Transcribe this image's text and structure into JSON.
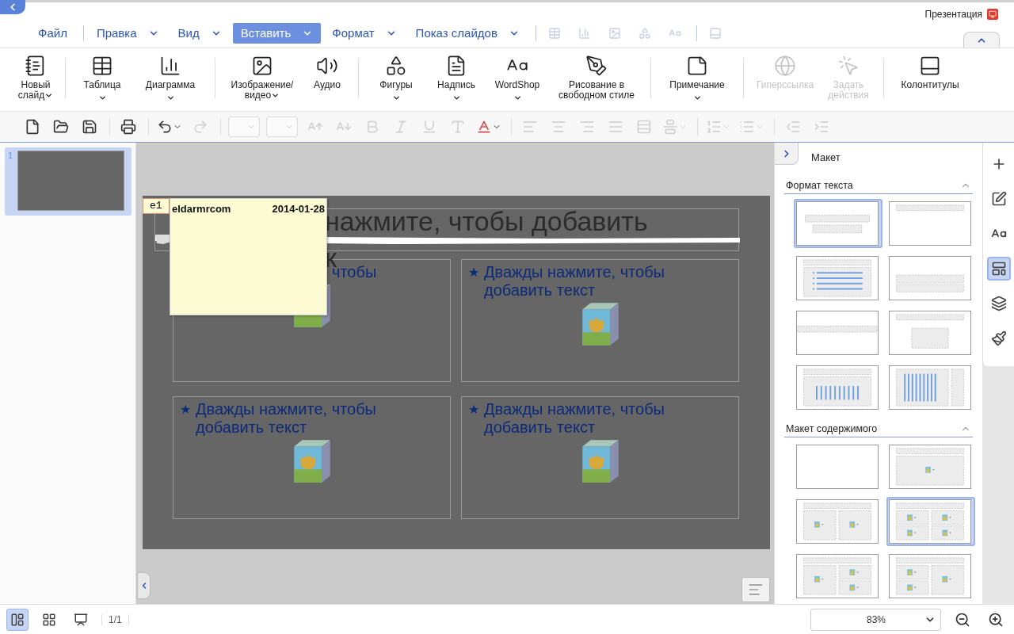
{
  "app": {
    "title": "Презентация"
  },
  "menu": [
    {
      "label": "Файл",
      "dropdown": false,
      "selected": false,
      "divider_before": false
    },
    {
      "label": "Правка",
      "dropdown": true,
      "selected": false,
      "divider_before": true
    },
    {
      "label": "Вид",
      "dropdown": true,
      "selected": false,
      "divider_before": false
    },
    {
      "label": "Вставить",
      "dropdown": true,
      "selected": true,
      "divider_before": false
    },
    {
      "label": "Формат",
      "dropdown": true,
      "selected": false,
      "divider_before": false
    },
    {
      "label": "Показ слайдов",
      "dropdown": true,
      "selected": false,
      "divider_before": false
    }
  ],
  "menu_icons": [
    {
      "kind": "table",
      "disabled": true,
      "divider_before": true
    },
    {
      "kind": "chart",
      "disabled": true,
      "divider_before": false
    },
    {
      "kind": "image",
      "disabled": true,
      "divider_before": false
    },
    {
      "kind": "shapes",
      "disabled": true,
      "divider_before": false
    },
    {
      "kind": "wordart",
      "disabled": true,
      "divider_before": false
    },
    {
      "kind": "footer",
      "disabled": true,
      "divider_before": true
    }
  ],
  "ribbon": [
    {
      "kind": "new-slide",
      "label": "Новый слайд",
      "dropdown": true,
      "disabled": false,
      "divider_before": false
    },
    {
      "kind": "table",
      "label": "Таблица",
      "dropdown": true,
      "disabled": false,
      "divider_before": true
    },
    {
      "kind": "chart",
      "label": "Диаграмма",
      "dropdown": true,
      "disabled": false,
      "divider_before": false
    },
    {
      "kind": "image",
      "label": "Изображение/ видео",
      "dropdown": true,
      "disabled": false,
      "divider_before": true
    },
    {
      "kind": "audio",
      "label": "Аудио",
      "dropdown": false,
      "disabled": false,
      "divider_before": false
    },
    {
      "kind": "shapes",
      "label": "Фигуры",
      "dropdown": true,
      "disabled": false,
      "divider_before": true
    },
    {
      "kind": "textbox",
      "label": "Надпись",
      "dropdown": true,
      "disabled": false,
      "divider_before": false
    },
    {
      "kind": "wordart",
      "label": "WordShop",
      "dropdown": true,
      "disabled": false,
      "divider_before": false
    },
    {
      "kind": "freehand",
      "label": "Рисование в свободном стиле",
      "dropdown": false,
      "disabled": false,
      "divider_before": false
    },
    {
      "kind": "note",
      "label": "Примечание",
      "dropdown": true,
      "disabled": false,
      "divider_before": true
    },
    {
      "kind": "hyperlink",
      "label": "Гиперссылка",
      "dropdown": false,
      "disabled": true,
      "divider_before": true
    },
    {
      "kind": "action",
      "label": "Задать действия",
      "dropdown": false,
      "disabled": true,
      "divider_before": false
    },
    {
      "kind": "header-footer",
      "label": "Колонтитулы",
      "dropdown": false,
      "disabled": false,
      "divider_before": true
    }
  ],
  "format_toolbar": [
    {
      "kind": "new",
      "disabled": false,
      "divider_before": false
    },
    {
      "kind": "open",
      "disabled": false,
      "divider_before": false
    },
    {
      "kind": "save",
      "disabled": false,
      "divider_before": false
    },
    {
      "kind": "print",
      "disabled": false,
      "divider_before": true
    },
    {
      "kind": "undo",
      "disabled": false,
      "divider_before": true
    },
    {
      "kind": "redo",
      "disabled": true,
      "divider_before": false
    },
    {
      "kind": "font-select",
      "disabled": true,
      "divider_before": true
    },
    {
      "kind": "size-select",
      "disabled": true,
      "divider_before": false
    },
    {
      "kind": "grow",
      "disabled": true,
      "divider_before": false
    },
    {
      "kind": "shrink",
      "disabled": true,
      "divider_before": false
    },
    {
      "kind": "bold",
      "disabled": true,
      "divider_before": false
    },
    {
      "kind": "italic",
      "disabled": true,
      "divider_before": false
    },
    {
      "kind": "underline",
      "disabled": true,
      "divider_before": false
    },
    {
      "kind": "shadow",
      "disabled": true,
      "divider_before": false
    },
    {
      "kind": "font-color",
      "disabled": false,
      "divider_before": false
    },
    {
      "kind": "align-left",
      "disabled": true,
      "divider_before": true
    },
    {
      "kind": "align-center",
      "disabled": true,
      "divider_before": false
    },
    {
      "kind": "align-right",
      "disabled": true,
      "divider_before": false
    },
    {
      "kind": "justify",
      "disabled": true,
      "divider_before": false
    },
    {
      "kind": "distribute",
      "disabled": true,
      "divider_before": false
    },
    {
      "kind": "valign",
      "disabled": true,
      "divider_before": false
    },
    {
      "kind": "numbering",
      "disabled": true,
      "divider_before": true
    },
    {
      "kind": "bullets",
      "disabled": true,
      "divider_before": false
    },
    {
      "kind": "outdent",
      "disabled": true,
      "divider_before": true
    },
    {
      "kind": "indent",
      "disabled": true,
      "divider_before": false
    }
  ],
  "slides": [
    {
      "number": "1",
      "selected": true
    }
  ],
  "slide": {
    "title": {
      "lines": [
        "нажмите, чтобы добавить",
        "к"
      ],
      "covered": true
    },
    "placeholders": [
      {
        "text": "чтобы",
        "covered": true
      },
      {
        "text": "Дважды нажмите, чтобы добавить текст",
        "bullet": "★",
        "covered": false
      },
      {
        "text": "Дважды нажмите, чтобы добавить текст",
        "bullet": "★",
        "covered": false
      },
      {
        "text": "Дважды нажмите, чтобы добавить текст",
        "bullet": "★",
        "covered": false
      }
    ],
    "comment": {
      "tag": "e1",
      "author": "eldarmrcom",
      "date": "2014-01-28"
    }
  },
  "panel": {
    "title": "Макет",
    "sections": [
      {
        "title": "Формат текста",
        "expanded": true,
        "layouts": [
          {
            "kind": "title",
            "selected": true
          },
          {
            "kind": "title-top",
            "selected": false
          },
          {
            "kind": "title-list",
            "selected": false
          },
          {
            "kind": "section",
            "selected": false
          },
          {
            "kind": "band",
            "selected": false
          },
          {
            "kind": "title-content",
            "selected": false
          },
          {
            "kind": "title-columns",
            "selected": false
          },
          {
            "kind": "vertical",
            "selected": false
          }
        ]
      },
      {
        "title": "Макет содержимого",
        "expanded": true,
        "layouts": [
          {
            "kind": "blank",
            "selected": false
          },
          {
            "kind": "content",
            "selected": false
          },
          {
            "kind": "two-content",
            "selected": false
          },
          {
            "kind": "four-content",
            "selected": true
          },
          {
            "kind": "left-big",
            "selected": false
          },
          {
            "kind": "right-big",
            "selected": false
          }
        ]
      }
    ]
  },
  "side_tabs": [
    {
      "kind": "add",
      "selected": false
    },
    {
      "kind": "shape-style",
      "selected": false
    },
    {
      "kind": "text-style",
      "selected": false
    },
    {
      "kind": "layout",
      "selected": true
    },
    {
      "kind": "transition",
      "selected": false
    },
    {
      "kind": "background",
      "selected": false
    }
  ],
  "status": {
    "views": [
      {
        "kind": "normal",
        "selected": true
      },
      {
        "kind": "sorter",
        "selected": false
      },
      {
        "kind": "show",
        "selected": false
      }
    ],
    "page": "1/1",
    "zoom": "83%"
  }
}
